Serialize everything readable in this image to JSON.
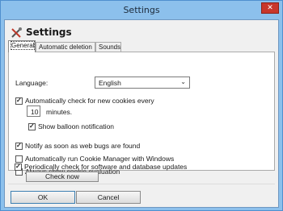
{
  "window": {
    "title": "Settings",
    "close_glyph": "✕"
  },
  "header": {
    "title": "Settings",
    "icon": "tools-icon"
  },
  "tabs": [
    {
      "label": "General",
      "active": true
    },
    {
      "label": "Automatic deletion",
      "active": false
    },
    {
      "label": "Sounds",
      "active": false
    }
  ],
  "general": {
    "language_label": "Language:",
    "language_value": "English",
    "auto_check_label": "Automatically check for new cookies every",
    "auto_check_checked": true,
    "interval_value": "10",
    "interval_unit": "minutes.",
    "balloon_label": "Show balloon notification",
    "balloon_checked": true,
    "web_bugs_label": "Notify as soon as web bugs are found",
    "web_bugs_checked": true,
    "auto_run_label": "Automatically run Cookie Manager with Windows",
    "auto_run_checked": false,
    "always_eval_label": "Always show cookie evaluation",
    "always_eval_checked": false,
    "periodic_label": "Periodically check for software and database updates",
    "periodic_checked": true,
    "check_now_label": "Check now"
  },
  "footer": {
    "ok_label": "OK",
    "cancel_label": "Cancel"
  },
  "colors": {
    "titlebar": "#8cc0ec",
    "close": "#c8372b",
    "client": "#f0f0f0",
    "panel": "#ffffff"
  }
}
